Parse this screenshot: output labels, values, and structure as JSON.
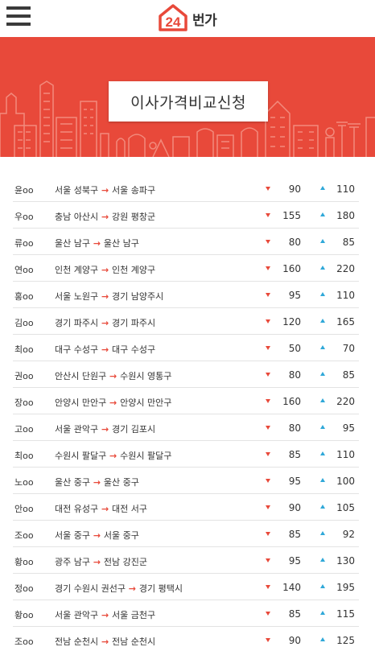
{
  "header": {
    "logo_number": "24",
    "logo_text": "번가"
  },
  "banner": {
    "title": "이사가격비교신청"
  },
  "colors": {
    "accent": "#e8493a",
    "price_down": "#e8493a",
    "price_up": "#2fa8d8"
  },
  "quotes": [
    {
      "name": "윤oo",
      "from": "서울 성북구",
      "to": "서울 송파구",
      "low": "90",
      "high": "110"
    },
    {
      "name": "우oo",
      "from": "충남 아산시",
      "to": "강원 평창군",
      "low": "155",
      "high": "180"
    },
    {
      "name": "류oo",
      "from": "울산 남구",
      "to": "울산 남구",
      "low": "80",
      "high": "85"
    },
    {
      "name": "연oo",
      "from": "인천 계양구",
      "to": "인천 계양구",
      "low": "160",
      "high": "220"
    },
    {
      "name": "홍oo",
      "from": "서울 노원구",
      "to": "경기 남양주시",
      "low": "95",
      "high": "110"
    },
    {
      "name": "김oo",
      "from": "경기 파주시",
      "to": "경기 파주시",
      "low": "120",
      "high": "165"
    },
    {
      "name": "최oo",
      "from": "대구 수성구",
      "to": "대구 수성구",
      "low": "50",
      "high": "70"
    },
    {
      "name": "권oo",
      "from": "안산시 단원구",
      "to": "수원시 영통구",
      "low": "80",
      "high": "85"
    },
    {
      "name": "장oo",
      "from": "안양시 만안구",
      "to": "안양시 만안구",
      "low": "160",
      "high": "220"
    },
    {
      "name": "고oo",
      "from": "서울 관악구",
      "to": "경기 김포시",
      "low": "80",
      "high": "95"
    },
    {
      "name": "최oo",
      "from": "수원시 팔달구",
      "to": "수원시 팔달구",
      "low": "85",
      "high": "110"
    },
    {
      "name": "노oo",
      "from": "울산 중구",
      "to": "울산 중구",
      "low": "95",
      "high": "100"
    },
    {
      "name": "안oo",
      "from": "대전 유성구",
      "to": "대전 서구",
      "low": "90",
      "high": "105"
    },
    {
      "name": "조oo",
      "from": "서울 중구",
      "to": "서울 중구",
      "low": "85",
      "high": "92"
    },
    {
      "name": "황oo",
      "from": "광주 남구",
      "to": "전남 강진군",
      "low": "95",
      "high": "130"
    },
    {
      "name": "정oo",
      "from": "경기 수원시 권선구",
      "to": "경기 평택시",
      "low": "140",
      "high": "195"
    },
    {
      "name": "황oo",
      "from": "서울 관악구",
      "to": "서울 금천구",
      "low": "85",
      "high": "115"
    },
    {
      "name": "조oo",
      "from": "전남 순천시",
      "to": "전남 순천시",
      "low": "90",
      "high": "125"
    }
  ]
}
